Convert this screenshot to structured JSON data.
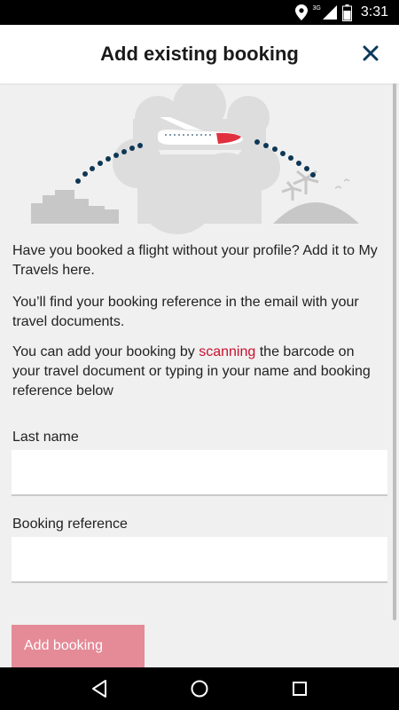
{
  "status": {
    "time": "3:31",
    "network": "3G"
  },
  "header": {
    "title": "Add existing booking"
  },
  "intro": {
    "line1": "Have you booked a flight without your profile? Add it to My Travels here.",
    "line2": "You’ll find your booking reference in the email with your travel documents.",
    "line3_before": "You can add your booking by ",
    "line3_link": "scanning",
    "line3_after": " the barcode on your travel document or typing in your name and booking reference below"
  },
  "form": {
    "last_name_label": "Last name",
    "last_name_value": "",
    "booking_ref_label": "Booking reference",
    "booking_ref_value": "",
    "submit_label": "Add booking"
  },
  "icons": {
    "close": "close-icon",
    "location": "location-icon",
    "signal": "signal-icon",
    "battery": "battery-icon",
    "back": "back-icon",
    "home": "home-icon",
    "recents": "recents-icon"
  },
  "colors": {
    "accent": "#c8102e",
    "button_disabled": "#e58a97",
    "header_icon": "#0b3a5a",
    "dots": "#0e3756"
  }
}
